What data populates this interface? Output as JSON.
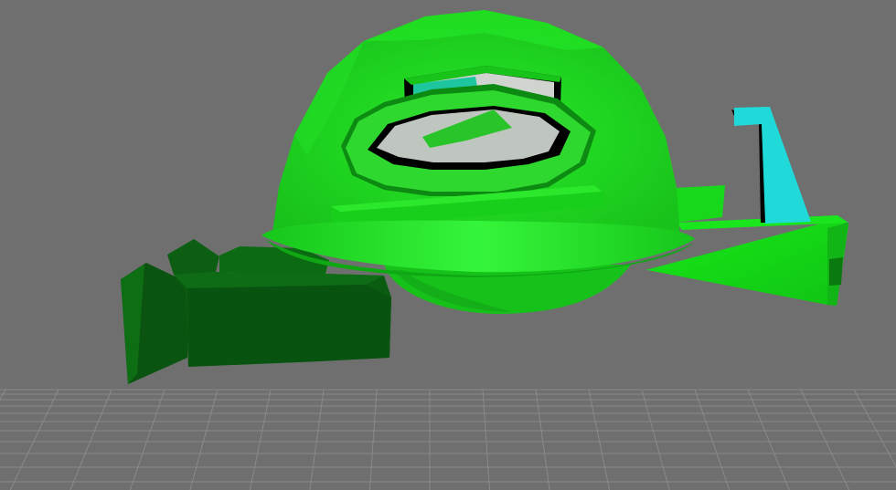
{
  "viewport": {
    "background_color": "#6f6f6f",
    "grid_color": "#8a8a8a"
  },
  "model": {
    "colors": {
      "dome_main": "#19d61c",
      "dome_highlight": "#3ef03c",
      "dome_shadow": "#0ea012",
      "dark_green": "#0b5a12",
      "dark_green_shadow": "#063f0b",
      "wing_green": "#16e016",
      "cyan_fin": "#1fd8d8",
      "window_glass": "#c9cfc9",
      "outline": "#000000"
    }
  }
}
